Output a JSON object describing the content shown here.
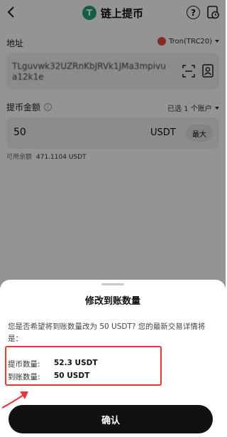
{
  "header": {
    "back_icon": "back-arrow-icon",
    "coin_logo": "T",
    "title": "链上提币",
    "help_icon": "help-icon",
    "help_glyph": "?",
    "history_icon": "history-icon"
  },
  "address": {
    "label": "地址",
    "network": "Tron(TRC20)",
    "value": "TLguvwk32UZRnKbJRVk1JMa3mpivua12k1e",
    "scan_icon": "scan-icon",
    "contact_icon": "address-book-icon"
  },
  "amount": {
    "label": "提币金额",
    "info_glyph": "i",
    "account_select": "已选 1 个账户",
    "value": "50",
    "unit": "USDT",
    "max_label": "最大",
    "available_label": "可用余额",
    "available_value": "471.1104 USDT"
  },
  "sheet": {
    "title": "修改到账数量",
    "message": "您是否希望将到账数量改为 50 USDT? 您的最新交易详情将是：",
    "rows": [
      {
        "label": "提币数量:",
        "value": "52.3 USDT"
      },
      {
        "label": "到账数量:",
        "value": "50 USDT"
      }
    ],
    "confirm_label": "确认"
  },
  "colors": {
    "brand_tether": "#26a17b",
    "tron": "#e8473c",
    "highlight": "#e53935",
    "button": "#111111"
  }
}
